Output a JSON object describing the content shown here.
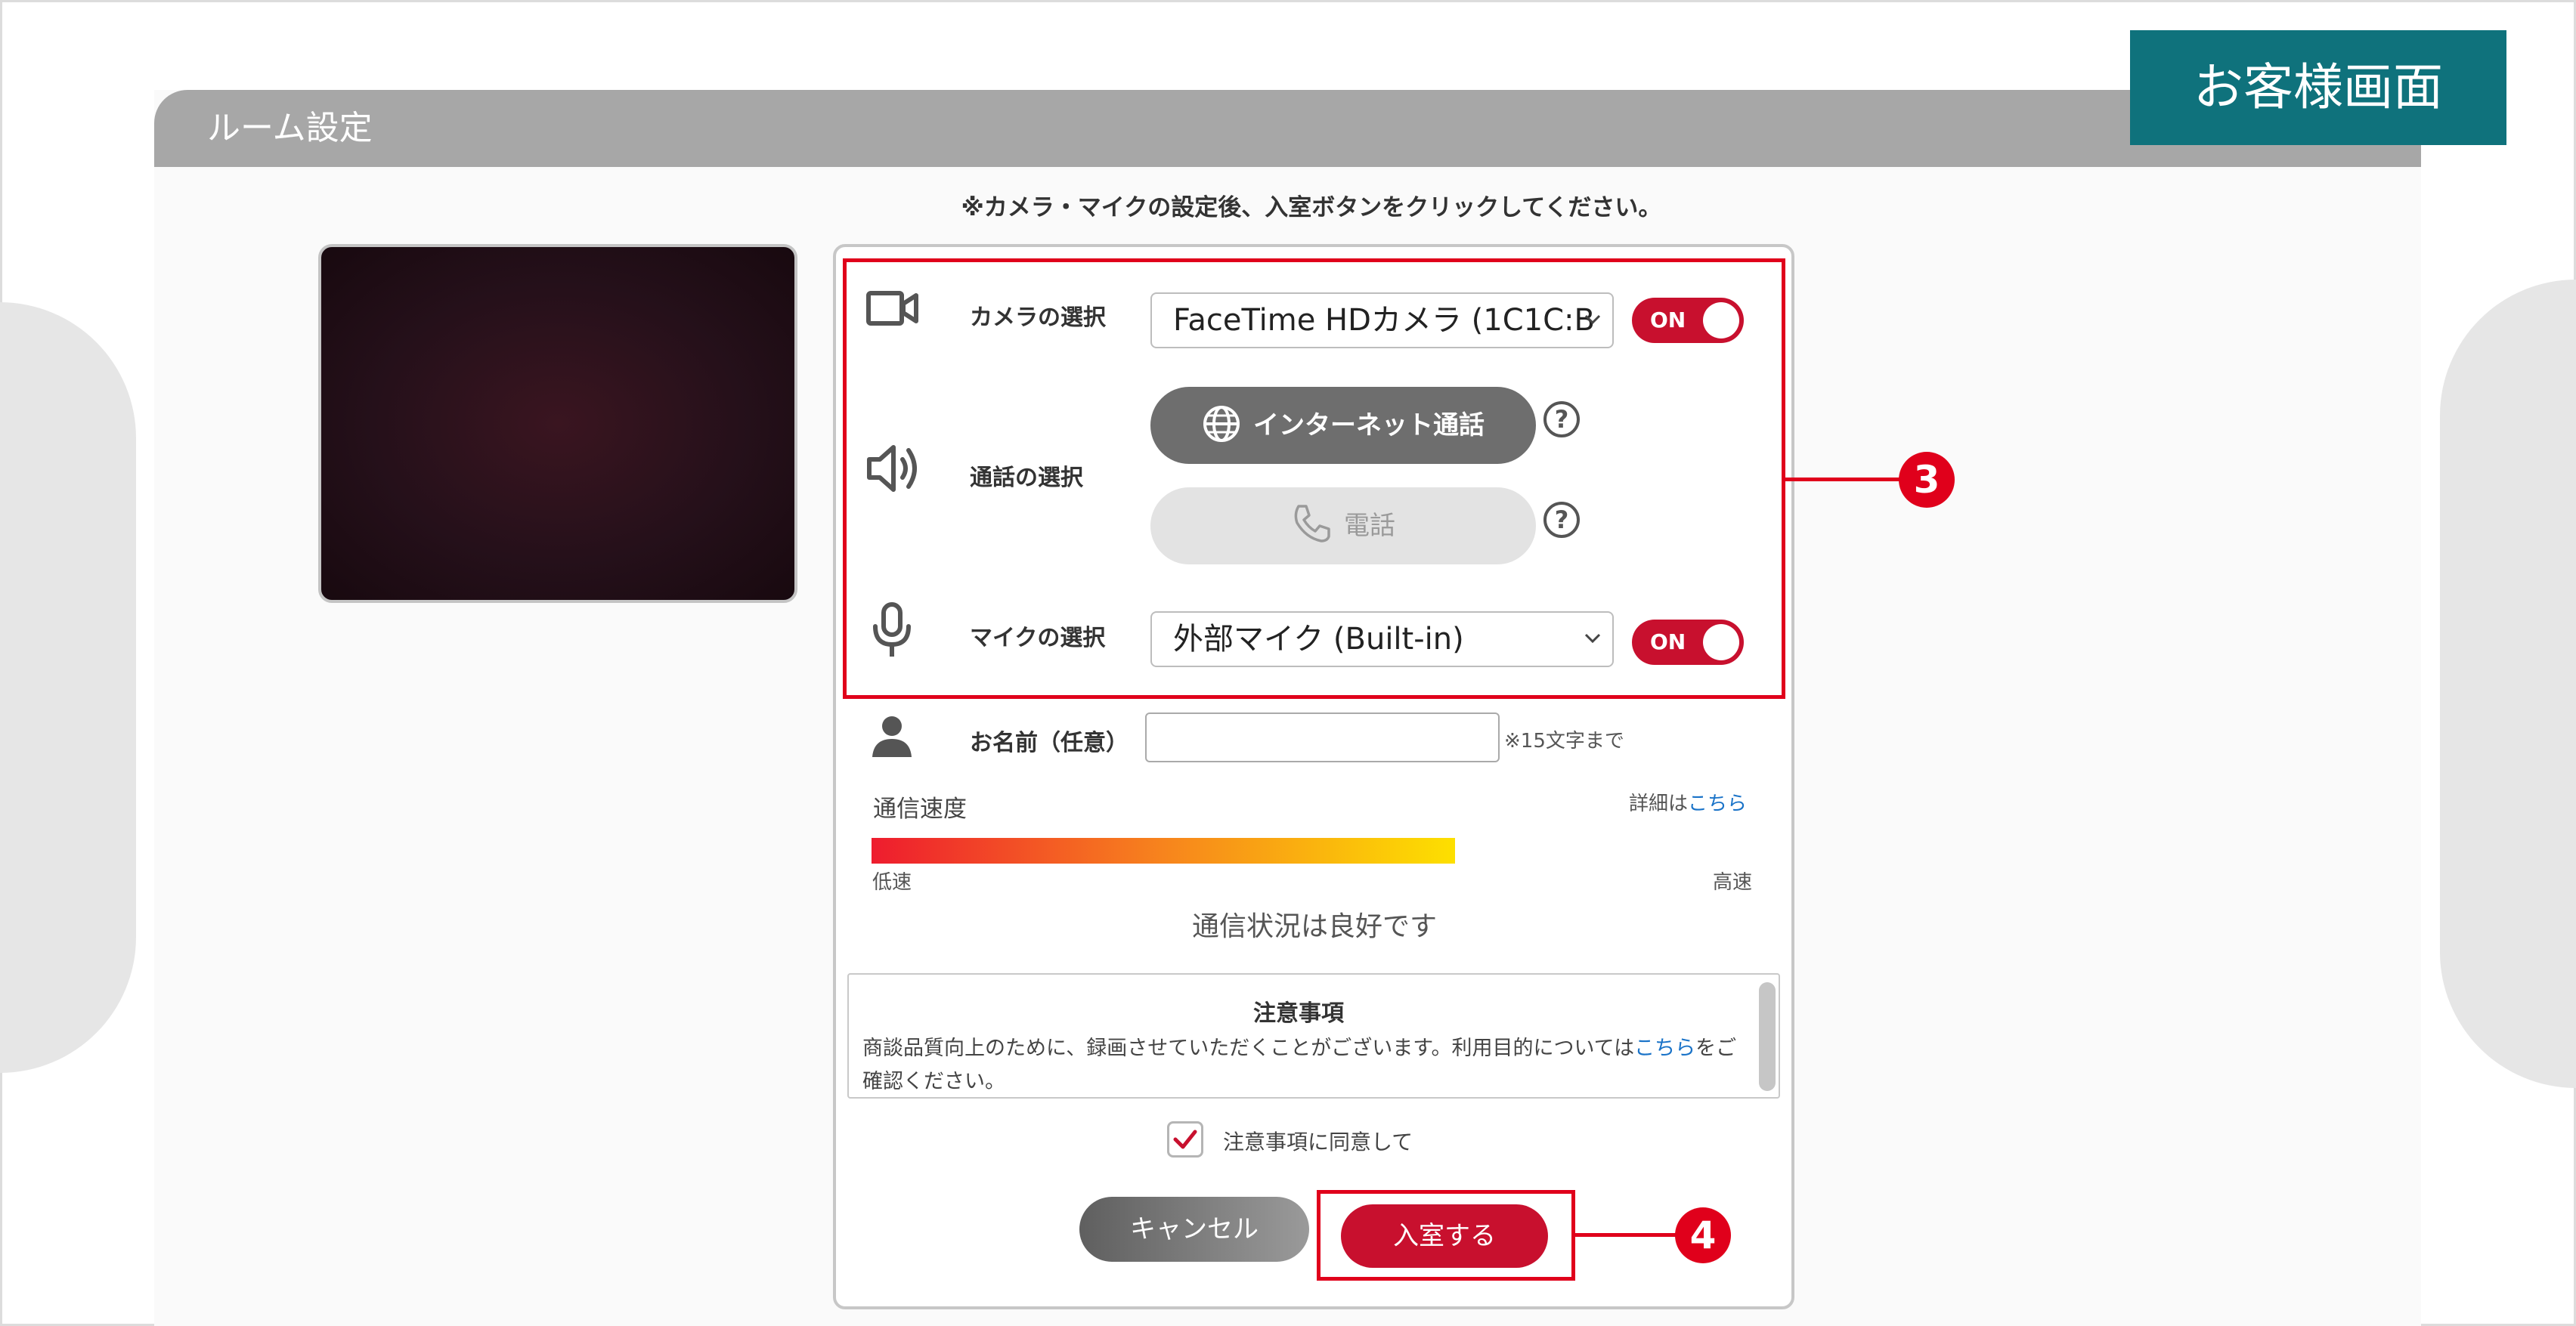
{
  "screen_badge": "お客様画面",
  "room_header": "ルーム設定",
  "instruction": "※カメラ・マイクの設定後、入室ボタンをクリックしてください。",
  "camera": {
    "label": "カメラの選択",
    "selected": "FaceTime HDカメラ (1C1C:B",
    "toggle": "ON"
  },
  "call": {
    "label": "通話の選択",
    "internet": "インターネット通話",
    "phone": "電話",
    "help": "?"
  },
  "mic": {
    "label": "マイクの選択",
    "selected": "外部マイク (Built-in)",
    "toggle": "ON"
  },
  "name": {
    "label": "お名前（任意）",
    "value": "",
    "hint": "※15文字まで"
  },
  "speed": {
    "label": "通信速度",
    "details_prefix": "詳細は",
    "details_link": "こちら",
    "low": "低速",
    "high": "高速",
    "level": 0.62,
    "status": "通信状況は良好です"
  },
  "notice": {
    "title": "注意事項",
    "body_before": "商談品質向上のために、録画させていただくことがございます。利用目的については",
    "body_link": "こちら",
    "body_after": "をご確認ください。"
  },
  "agree": {
    "label": "注意事項に同意して",
    "checked": true
  },
  "buttons": {
    "cancel": "キャンセル",
    "enter": "入室する"
  },
  "annotations": {
    "step3": "3",
    "step4": "4"
  },
  "colors": {
    "accent_red": "#c8102e",
    "annotation_red": "#e0001b",
    "badge_teal": "#0f727c",
    "header_gray": "#a7a7a7",
    "link_blue": "#1a73c8"
  }
}
